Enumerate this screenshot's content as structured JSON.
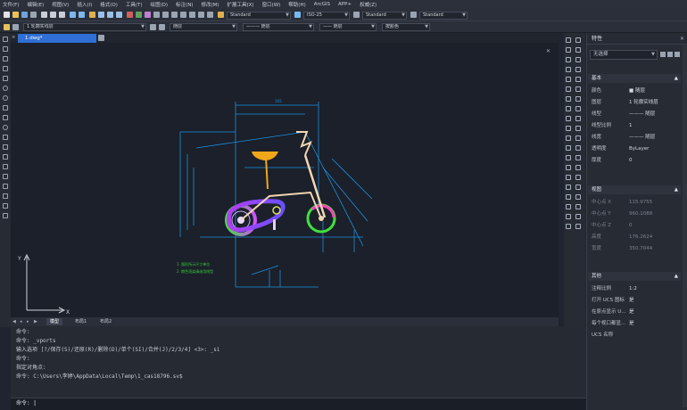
{
  "menubar": [
    "文件(F)",
    "编辑(E)",
    "视图(V)",
    "插入(I)",
    "格式(O)",
    "工具(T)",
    "绘图(D)",
    "标注(N)",
    "修改(M)",
    "扩展工具(X)",
    "窗口(W)",
    "帮助(H)",
    "ArcGIS",
    "APP+",
    "权威(Z)"
  ],
  "toolbar": {
    "text_style": "Standard",
    "dim_style": "ISO-25",
    "table_style": "Standard",
    "multileader_style": "Standard",
    "layer_state": "1 轮廓实线层",
    "color": "随层",
    "linetype": "随层",
    "lineweight": "随层",
    "plot_style": "按颜色"
  },
  "document_tab": "1.dwg*",
  "drawing_notes": [
    "1. 图形所示尺寸单位",
    "2. 颜色渲染请选用线型"
  ],
  "dims": {
    "d165": "165"
  },
  "ucs": {
    "x": "X",
    "y": "Y"
  },
  "bottom_tabs": [
    "模型",
    "布局1",
    "布局2"
  ],
  "command_history": [
    "命令:",
    "命令: _vports",
    "输入选项 [?/保存(S)/还原(R)/删除(D)/单个(SI)/合并(J)/2/3/4] <3>: _si",
    "命令:",
    "指定对角点:",
    "命令: C:\\Users\\李婷\\AppData\\Local\\Temp\\1_cas18796.sv$"
  ],
  "command_prompt": "命令:",
  "properties": {
    "title": "特性",
    "selection": "无选择",
    "sections": {
      "general": "基本",
      "view": "视图",
      "misc": "其他"
    },
    "general_rows": [
      {
        "key": "颜色",
        "value": "■ 随层"
      },
      {
        "key": "图层",
        "value": "1 轮廓实线层"
      },
      {
        "key": "线型",
        "value": "——— 随层"
      },
      {
        "key": "线型比例",
        "value": "1"
      },
      {
        "key": "线宽",
        "value": "——— 随层"
      },
      {
        "key": "透明度",
        "value": "ByLayer"
      },
      {
        "key": "厚度",
        "value": "0"
      }
    ],
    "view_rows": [
      {
        "key": "中心点 X",
        "value": "115.9755"
      },
      {
        "key": "中心点 Y",
        "value": "960.1088"
      },
      {
        "key": "中心点 Z",
        "value": "0"
      },
      {
        "key": "高度",
        "value": "176.2624"
      },
      {
        "key": "宽度",
        "value": "350.7044"
      }
    ],
    "misc_rows": [
      {
        "key": "注释比例",
        "value": "1:2"
      },
      {
        "key": "打开 UCS 图标",
        "value": "是"
      },
      {
        "key": "在原点显示 U...",
        "value": "是"
      },
      {
        "key": "每个视口都显...",
        "value": "是"
      },
      {
        "key": "UCS 名称",
        "value": ""
      }
    ]
  },
  "colors": {
    "accent": "#2f6fd6",
    "canvas": "#1b202a",
    "dimension": "#1d8fe0",
    "seat": "#f0a81a",
    "frame": "#f2d6b0"
  }
}
